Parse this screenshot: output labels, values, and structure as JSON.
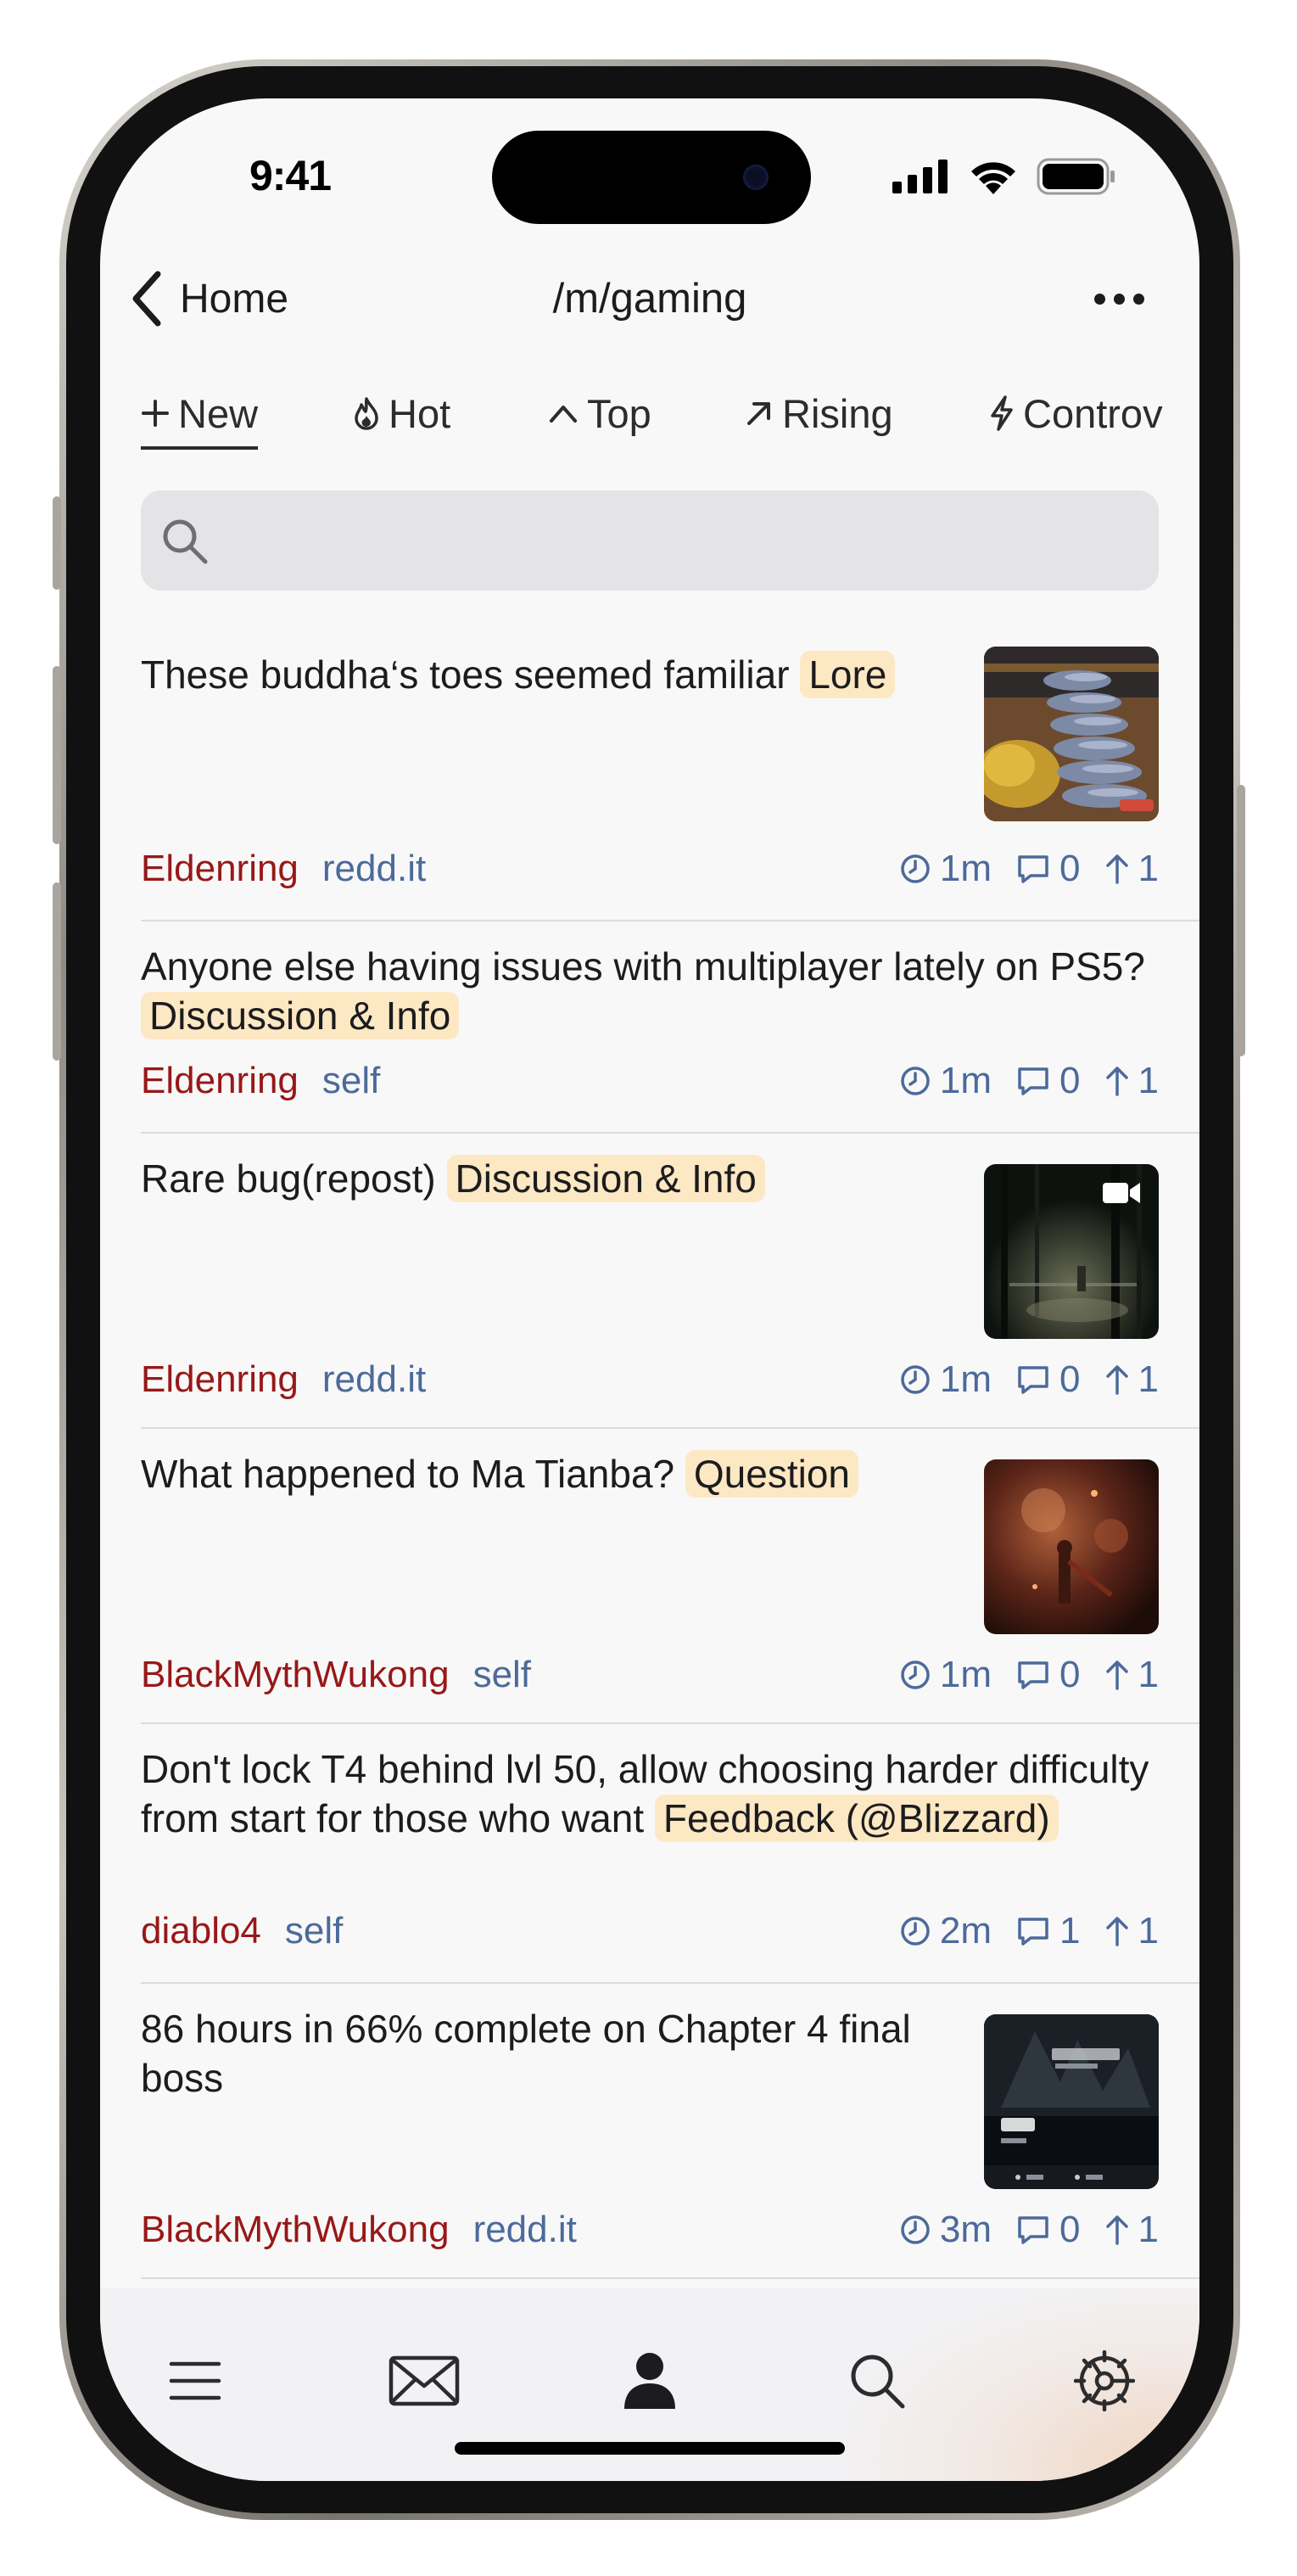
{
  "status_bar": {
    "time": "9:41"
  },
  "nav": {
    "back_label": "Home",
    "title": "/m/gaming"
  },
  "sort_tabs": [
    {
      "label": "New",
      "icon": "plus-icon",
      "active": true
    },
    {
      "label": "Hot",
      "icon": "flame-icon",
      "active": false
    },
    {
      "label": "Top",
      "icon": "chevron-up-icon",
      "active": false
    },
    {
      "label": "Rising",
      "icon": "arrow-up-right-icon",
      "active": false
    },
    {
      "label": "Controv",
      "icon": "bolt-icon",
      "active": false
    }
  ],
  "search": {
    "placeholder": "",
    "value": ""
  },
  "posts": [
    {
      "title": "These buddha‘s toes seemed familiar",
      "flair": "Lore",
      "community": "Eldenring",
      "domain": "redd.it",
      "age": "1m",
      "comments": "0",
      "votes": "1",
      "thumbnail": "reclining-buddha-photo",
      "video": false
    },
    {
      "title": "Anyone else having issues with multiplayer lately on PS5?",
      "flair": "Discussion & Info",
      "community": "Eldenring",
      "domain": "self",
      "age": "1m",
      "comments": "0",
      "votes": "1",
      "thumbnail": null,
      "video": false
    },
    {
      "title": "Rare bug(repost)",
      "flair": "Discussion & Info",
      "community": "Eldenring",
      "domain": "redd.it",
      "age": "1m",
      "comments": "0",
      "votes": "1",
      "thumbnail": "dark-forest-video",
      "video": true
    },
    {
      "title": "What happened to Ma Tianba?",
      "flair": "Question",
      "community": "BlackMythWukong",
      "domain": "self",
      "age": "1m",
      "comments": "0",
      "votes": "1",
      "thumbnail": "fiery-scene-photo",
      "video": false
    },
    {
      "title": "Don't lock T4 behind lvl 50, allow choosing harder difficulty from start for those who want",
      "flair": "Feedback (@Blizzard)",
      "community": "diablo4",
      "domain": "self",
      "age": "2m",
      "comments": "1",
      "votes": "1",
      "thumbnail": null,
      "video": false
    },
    {
      "title": "86 hours in 66% complete on Chapter 4 final boss",
      "flair": "",
      "community": "BlackMythWukong",
      "domain": "redd.it",
      "age": "3m",
      "comments": "0",
      "votes": "1",
      "thumbnail": "wukong-screen-photo",
      "video": false
    }
  ],
  "tab_bar": [
    {
      "name": "menu-icon"
    },
    {
      "name": "inbox-icon"
    },
    {
      "name": "profile-icon"
    },
    {
      "name": "search-icon"
    },
    {
      "name": "settings-icon"
    }
  ],
  "colors": {
    "community": "#981818",
    "meta_blue": "#4c6a9a",
    "flair_bg": "#fde8c4",
    "text": "#1c1c1e"
  }
}
